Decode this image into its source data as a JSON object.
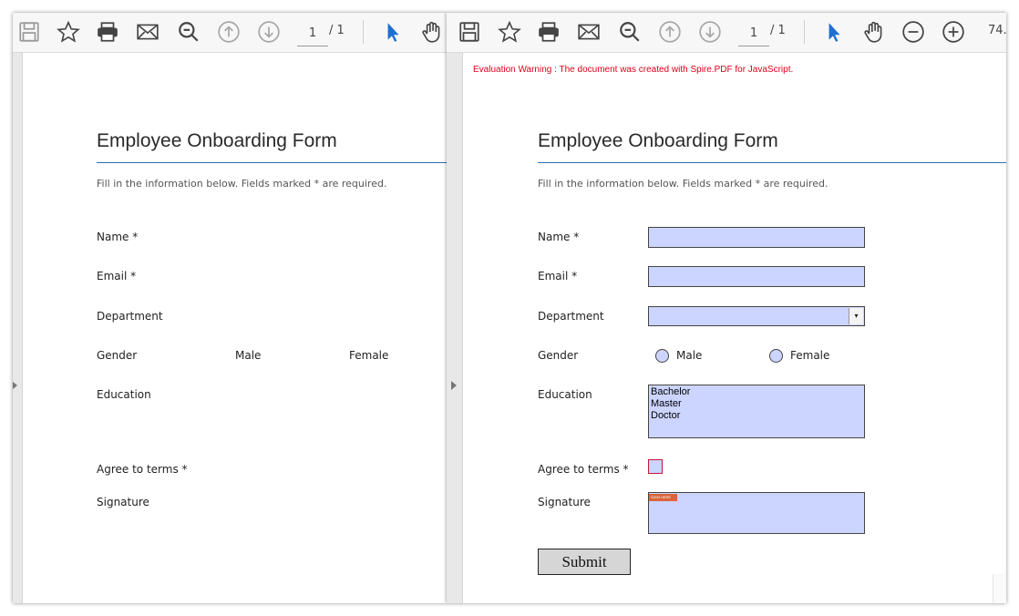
{
  "toolbar": {
    "page_current": "1",
    "page_total": "/ 1",
    "zoom": "74.",
    "icons": [
      "save-icon",
      "star-icon",
      "print-icon",
      "mail-icon",
      "search-icon",
      "up-arrow-icon",
      "down-arrow-icon",
      "cursor-icon",
      "hand-icon",
      "zoom-out-icon",
      "zoom-in-icon"
    ]
  },
  "form": {
    "title": "Employee Onboarding Form",
    "subtitle": "Fill in the information below. Fields marked * are required.",
    "labels": {
      "name": "Name *",
      "email": "Email *",
      "department": "Department",
      "gender": "Gender",
      "male": "Male",
      "female": "Female",
      "education": "Education",
      "agree": "Agree to terms *",
      "signature": "Signature"
    },
    "education_options": [
      "Bachelor",
      "Master",
      "Doctor"
    ],
    "submit_label": "Submit",
    "signature_tag": "SIGN HERE",
    "dropdown_arrow": "▾"
  },
  "warning": "Evaluation Warning : The document was created with Spire.PDF for JavaScript.",
  "colors": {
    "field_fill": "#ccd5ff",
    "accent_rule": "#2d6db5",
    "warning": "#e0001a",
    "cursor_blue": "#1e6fd1"
  }
}
